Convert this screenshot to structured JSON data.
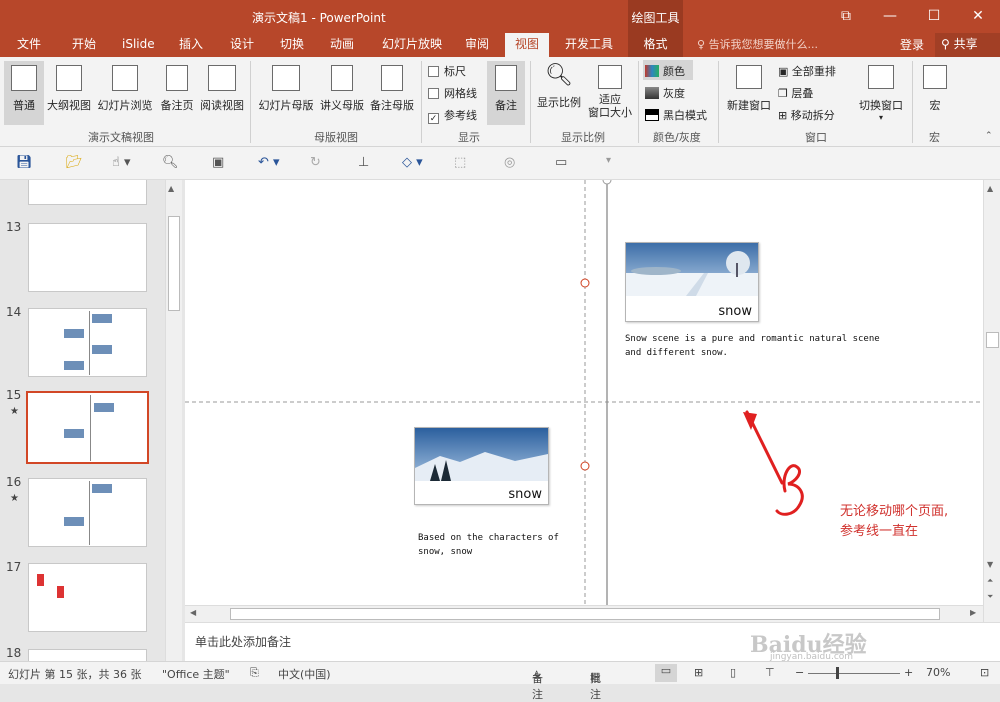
{
  "window": {
    "title": "演示文稿1 - PowerPoint",
    "context_tab": "绘图工具",
    "controls": [
      "restore-ribbon",
      "minimize",
      "maximize",
      "close"
    ]
  },
  "tabs": [
    "文件",
    "开始",
    "iSlide",
    "插入",
    "设计",
    "切换",
    "动画",
    "幻灯片放映",
    "审阅",
    "视图",
    "开发工具",
    "格式"
  ],
  "active_tab": "视图",
  "tell_me": "告诉我您想要做什么...",
  "login": "登录",
  "share": "共享",
  "ribbon": {
    "views": [
      "普通",
      "大纲视图",
      "幻灯片浏览",
      "备注页",
      "阅读视图"
    ],
    "views_group": "演示文稿视图",
    "masters": [
      "幻灯片母版",
      "讲义母版",
      "备注母版"
    ],
    "masters_group": "母版视图",
    "show": {
      "ruler": "标尺",
      "gridlines": "网格线",
      "guides": "参考线",
      "notes": "备注"
    },
    "show_group": "显示",
    "zoom": {
      "zoom": "显示比例",
      "fit": "适应\n窗口大小"
    },
    "zoom_group": "显示比例",
    "color": {
      "color": "颜色",
      "gray": "灰度",
      "bw": "黑白模式"
    },
    "color_group": "颜色/灰度",
    "window": {
      "new": "新建窗口",
      "arrange": "全部重排",
      "cascade": "层叠",
      "split": "移动拆分",
      "switch": "切换窗口"
    },
    "window_group": "窗口",
    "macro": "宏",
    "macro_group": "宏"
  },
  "thumbnails": [
    {
      "num": "13",
      "star": false
    },
    {
      "num": "14",
      "star": false
    },
    {
      "num": "15",
      "star": true
    },
    {
      "num": "16",
      "star": true
    },
    {
      "num": "17",
      "star": false
    },
    {
      "num": "18",
      "star": false
    }
  ],
  "slide": {
    "card1_caption": "snow",
    "card1_text": "Snow scene is a pure and romantic natural scene\nand different snow.",
    "card2_caption": "snow",
    "card2_text": "Based on the characters of\nsnow, snow",
    "annotation_number": "3",
    "annotation_text": "无论移动哪个页面,\n参考线一直在"
  },
  "notes_placeholder": "单击此处添加备注",
  "status": {
    "slide_count": "幻灯片 第 15 张，共 36 张",
    "theme": "\"Office 主题\"",
    "language": "中文(中国)",
    "notes": "备注",
    "comments": "批注",
    "zoom": "70%"
  },
  "watermark": {
    "brand": "Baidu经验",
    "url": "jingyan.baidu.com"
  },
  "colors": {
    "brand": "#b7472a",
    "selection": "#d24726",
    "annotation": "#d0312d"
  }
}
